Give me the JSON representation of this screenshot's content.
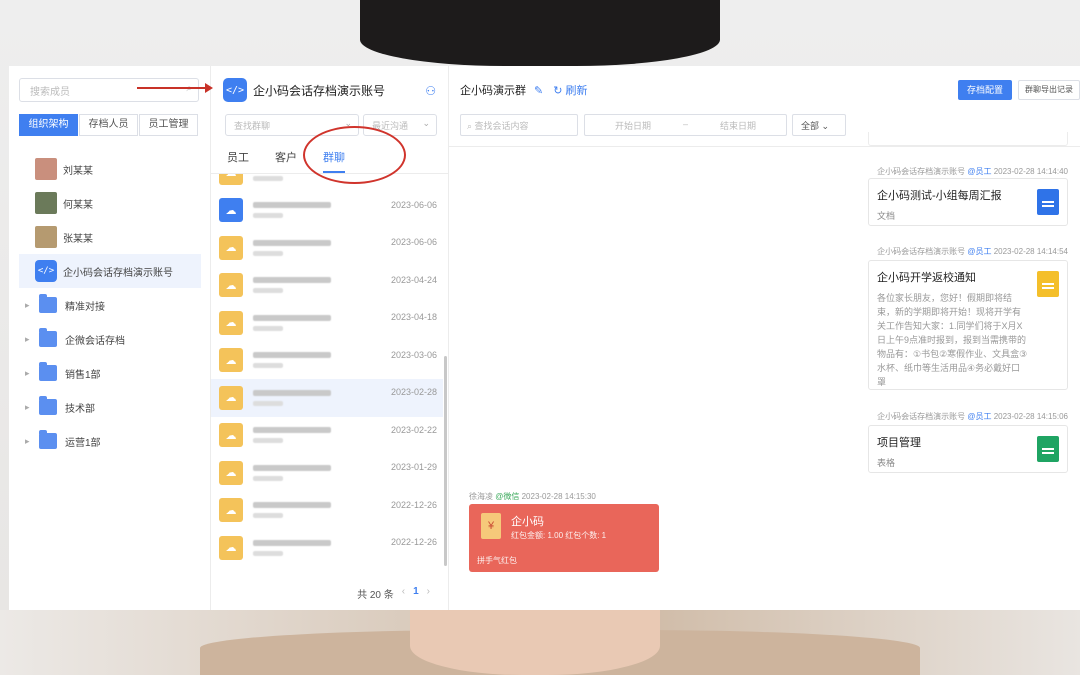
{
  "left": {
    "search_placeholder": "搜索成员",
    "segments": [
      {
        "label": "组织架构",
        "active": true
      },
      {
        "label": "存档人员",
        "active": false
      },
      {
        "label": "员工管理",
        "active": false
      }
    ],
    "tree": [
      {
        "type": "person",
        "label": "刘某某",
        "color": "#c98f7d"
      },
      {
        "type": "person",
        "label": "何某某",
        "color": "#6b7a5a"
      },
      {
        "type": "person",
        "label": "张某某",
        "color": "#b59a70"
      },
      {
        "type": "account",
        "label": "企小码会话存档演示账号",
        "selected": true
      },
      {
        "type": "folder",
        "label": "精准对接"
      },
      {
        "type": "folder",
        "label": "企微会话存档"
      },
      {
        "type": "folder",
        "label": "销售1部"
      },
      {
        "type": "folder",
        "label": "技术部"
      },
      {
        "type": "folder",
        "label": "运营1部"
      }
    ]
  },
  "mid": {
    "account_title": "企小码会话存档演示账号",
    "select_group_placeholder": "查找群聊",
    "select_recent_placeholder": "最近沟通",
    "tabs": [
      {
        "label": "员工",
        "active": false
      },
      {
        "label": "客户",
        "active": false
      },
      {
        "label": "群聊",
        "active": true
      }
    ],
    "rows": [
      {
        "date": "",
        "icon": "yellow"
      },
      {
        "date": "2023-06-06",
        "icon": "blue"
      },
      {
        "date": "2023-06-06",
        "icon": "yellow"
      },
      {
        "date": "2023-04-24",
        "icon": "yellow"
      },
      {
        "date": "2023-04-18",
        "icon": "yellow"
      },
      {
        "date": "2023-03-06",
        "icon": "yellow"
      },
      {
        "date": "2023-02-28",
        "icon": "yellow",
        "selected": true
      },
      {
        "date": "2023-02-22",
        "icon": "yellow"
      },
      {
        "date": "2023-01-29",
        "icon": "yellow"
      },
      {
        "date": "2022-12-26",
        "icon": "yellow"
      },
      {
        "date": "2022-12-26",
        "icon": "yellow"
      }
    ],
    "total_text": "共 20 条",
    "current_page": "1"
  },
  "right": {
    "chat_title": "企小码演示群",
    "refresh_label": "刷新",
    "primary_btn": "存档配置",
    "default_btn": "群聊导出记录",
    "search_placeholder": "查找会话内容",
    "start_date": "开始日期",
    "date_sep": "–",
    "end_date": "结束日期",
    "filter_all": "全部",
    "messages": [
      {
        "sender": "企小码会话存档演示账号",
        "tag": "@员工",
        "time": "2023-02-28 14:14:40",
        "card_title": "企小码测试-小组每周汇报",
        "card_sub": "文档",
        "icon": "blue"
      },
      {
        "sender": "企小码会话存档演示账号",
        "tag": "@员工",
        "time": "2023-02-28 14:14:54",
        "card_title": "企小码开学返校通知",
        "card_body": "各位家长朋友，您好！假期即将结束，新的学期即将开始！现将开学有关工作告知大家：1.同学们将于X月X日上午9点准时报到，报到当需携带的物品有：①书包②寒假作业、文具盒③水杯、纸巾等生活用品④务必戴好口罩",
        "icon": "yellow"
      },
      {
        "sender": "企小码会话存档演示账号",
        "tag": "@员工",
        "time": "2023-02-28 14:15:06",
        "card_title": "项目管理",
        "card_sub": "表格",
        "icon": "green"
      }
    ],
    "redpacket_meta": {
      "sender": "徐海凌",
      "tag": "@微信",
      "time": "2023-02-28 14:15:30"
    },
    "redpacket": {
      "title": "企小码",
      "info": "红包金额: 1.00    红包个数: 1",
      "foot": "拼手气红包"
    }
  }
}
